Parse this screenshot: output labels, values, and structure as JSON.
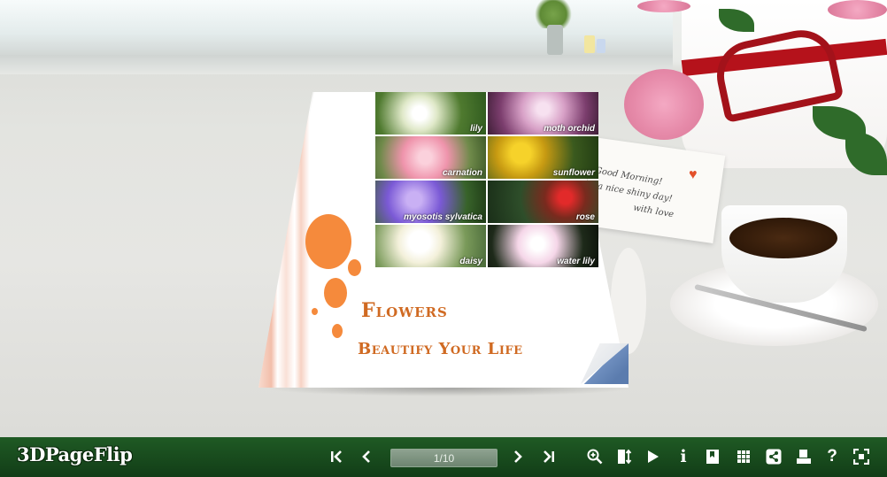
{
  "book": {
    "cover_title": "Flowers",
    "cover_subtitle": "Beautify Your Life",
    "photos": [
      {
        "label": "lily"
      },
      {
        "label": "moth orchid"
      },
      {
        "label": "carnation"
      },
      {
        "label": "sunflower"
      },
      {
        "label": "myosotis sylvatica"
      },
      {
        "label": "rose"
      },
      {
        "label": "daisy"
      },
      {
        "label": "water lily"
      }
    ]
  },
  "background": {
    "card_line1": "Good Morning!",
    "card_line2": "a nice shiny day!",
    "card_line3": "with love"
  },
  "toolbar": {
    "brand": "3DPageFlip",
    "page_indicator": "1/10",
    "buttons": [
      "first-page",
      "previous-page",
      "next-page",
      "last-page",
      "zoom-in",
      "auto-flip",
      "play",
      "info",
      "bookmark",
      "thumbnails",
      "share",
      "print",
      "help",
      "fullscreen"
    ]
  },
  "colors": {
    "toolbar_bg": "#1a4d1f",
    "cover_text": "#d06a22",
    "accent_dots": "#f58a3c"
  }
}
